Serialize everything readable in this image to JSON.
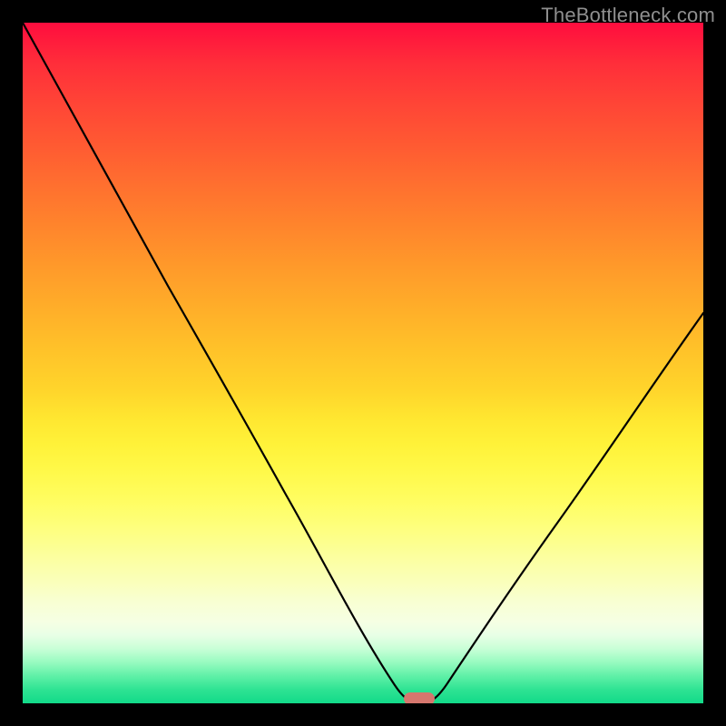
{
  "watermark": "TheBottleneck.com",
  "chart_data": {
    "type": "line",
    "title": "",
    "xlabel": "",
    "ylabel": "",
    "xlim": [
      0,
      100
    ],
    "ylim": [
      0,
      100
    ],
    "grid": false,
    "legend": null,
    "background_gradient_top_color": "#ff0d3e",
    "background_gradient_bottom_color": "#12da89",
    "series": [
      {
        "name": "bottleneck-curve",
        "x": [
          0,
          4,
          8,
          12,
          16,
          20,
          24,
          28,
          32,
          36,
          40,
          44,
          48,
          52,
          55,
          58,
          60,
          62,
          64,
          68,
          72,
          76,
          80,
          84,
          88,
          92,
          96,
          100
        ],
        "y": [
          100,
          93,
          86,
          79,
          73,
          66,
          59,
          53,
          46,
          40,
          33,
          26,
          18,
          9,
          2,
          0,
          0,
          2,
          6,
          14,
          22,
          29,
          36,
          42,
          48,
          54,
          59,
          64
        ],
        "stroke": "#000000"
      }
    ],
    "annotations": [
      {
        "name": "optimal-marker",
        "x": 58.5,
        "y": 0,
        "shape": "rounded-rect",
        "color": "#d6776e"
      }
    ]
  }
}
